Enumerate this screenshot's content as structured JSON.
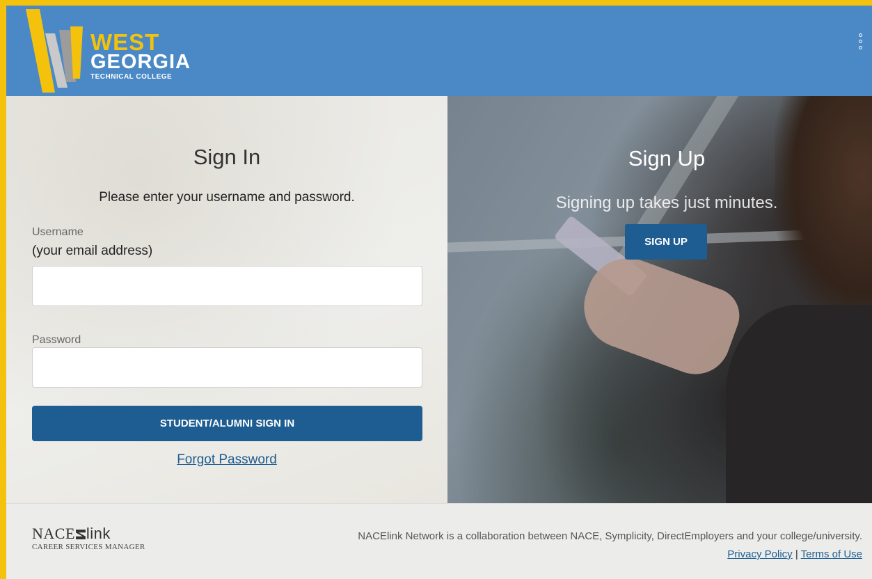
{
  "header": {
    "logo": {
      "line1": "WEST",
      "line2": "GEORGIA",
      "line3": "TECHNICAL COLLEGE"
    },
    "menu_icon": "vertical-dots-icon"
  },
  "signin": {
    "title": "Sign In",
    "subtitle": "Please enter your username and password.",
    "username_label": "Username",
    "username_hint": "(your email address)",
    "username_value": "",
    "password_label": "Password",
    "password_value": "",
    "button_label": "STUDENT/ALUMNI SIGN IN",
    "forgot_label": "Forgot Password"
  },
  "signup": {
    "title": "Sign Up",
    "subtitle": "Signing up takes just minutes.",
    "button_label": "SIGN UP"
  },
  "footer": {
    "logo_main": "NACE",
    "logo_link": "link",
    "logo_sub": "CAREER SERVICES MANAGER",
    "network_text": "NACElink Network is a collaboration between NACE, Symplicity, DirectEmployers and your college/university.",
    "privacy_label": "Privacy Policy",
    "separator": "|",
    "terms_label": "Terms of Use"
  },
  "colors": {
    "border_accent": "#f4c20d",
    "header_bg": "#4a89c6",
    "button_bg": "#1e5d91",
    "link": "#1e5d91"
  }
}
